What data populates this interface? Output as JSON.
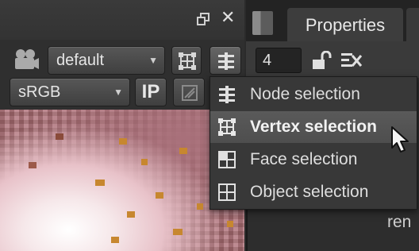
{
  "viewer": {
    "header": {
      "float_icon": "float-window-icon",
      "close_icon": "close-icon"
    },
    "toolbar": {
      "camera_icon": "camera-icon",
      "camera_dropdown": {
        "value": "default"
      },
      "vertex_selection_icon": "vertex-selection-icon",
      "node_selection_button_icon": "node-selection-icon",
      "colorspace_dropdown": {
        "value": "sRGB"
      },
      "ip_button": {
        "label": "IP"
      },
      "mask_icon": "mask-icon"
    }
  },
  "properties": {
    "panel_icon": "panel-icon",
    "tab_label": "Properties",
    "number_field": "4",
    "lock_icon": "unlock-icon",
    "clear_icon": "clear-icon",
    "bottom_text": "ren"
  },
  "selection_menu": {
    "items": [
      {
        "label": "Node selection",
        "icon": "node-selection-icon"
      },
      {
        "label": "Vertex selection",
        "icon": "vertex-selection-icon",
        "active": true
      },
      {
        "label": "Face selection",
        "icon": "face-selection-icon"
      },
      {
        "label": "Object selection",
        "icon": "object-selection-icon"
      }
    ]
  },
  "colors": {
    "panel_bg": "#2b2b2b",
    "menu_bg": "#383838",
    "menu_active_bg": "#555555",
    "text": "#dedede"
  }
}
